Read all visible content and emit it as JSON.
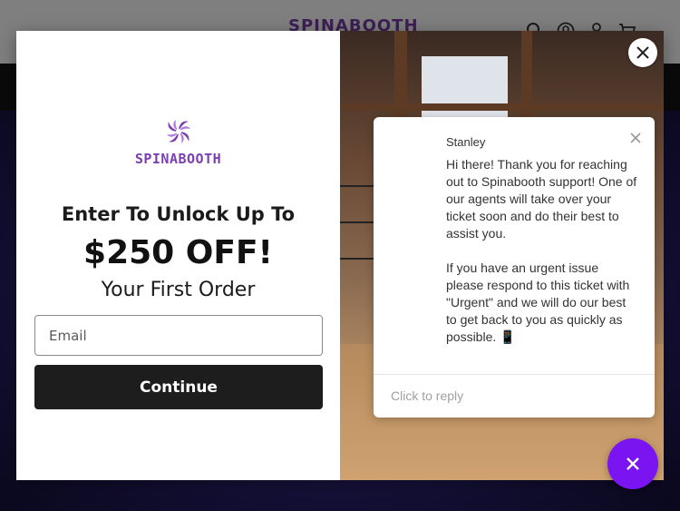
{
  "site": {
    "logo_text": "SPINABOOTH",
    "icons": [
      "search-icon",
      "user-circle-icon",
      "account-icon",
      "cart-icon"
    ]
  },
  "popup": {
    "brand_name": "SPINABOOTH",
    "headline": "Enter To Unlock Up To",
    "offer": "$250 OFF!",
    "subline": "Your First Order",
    "email_placeholder": "Email",
    "continue_label": "Continue",
    "close_icon": "close-icon"
  },
  "chat": {
    "agent_name": "Stanley",
    "message": "Hi there! Thank you for reaching out to Spinabooth support! One of our agents will take over your ticket soon and do their best to assist you.\n\nIf you have an urgent issue please respond to this ticket with \"Urgent\" and we will do our best to get back to you as quickly as possible. 📱",
    "reply_placeholder": "Click to reply",
    "close_icon": "close-icon"
  },
  "launcher": {
    "icon": "close-icon"
  },
  "colors": {
    "brand_purple": "#7b3fb0",
    "button_dark": "#1d1d1d",
    "launcher_purple": "#7a14f0"
  }
}
